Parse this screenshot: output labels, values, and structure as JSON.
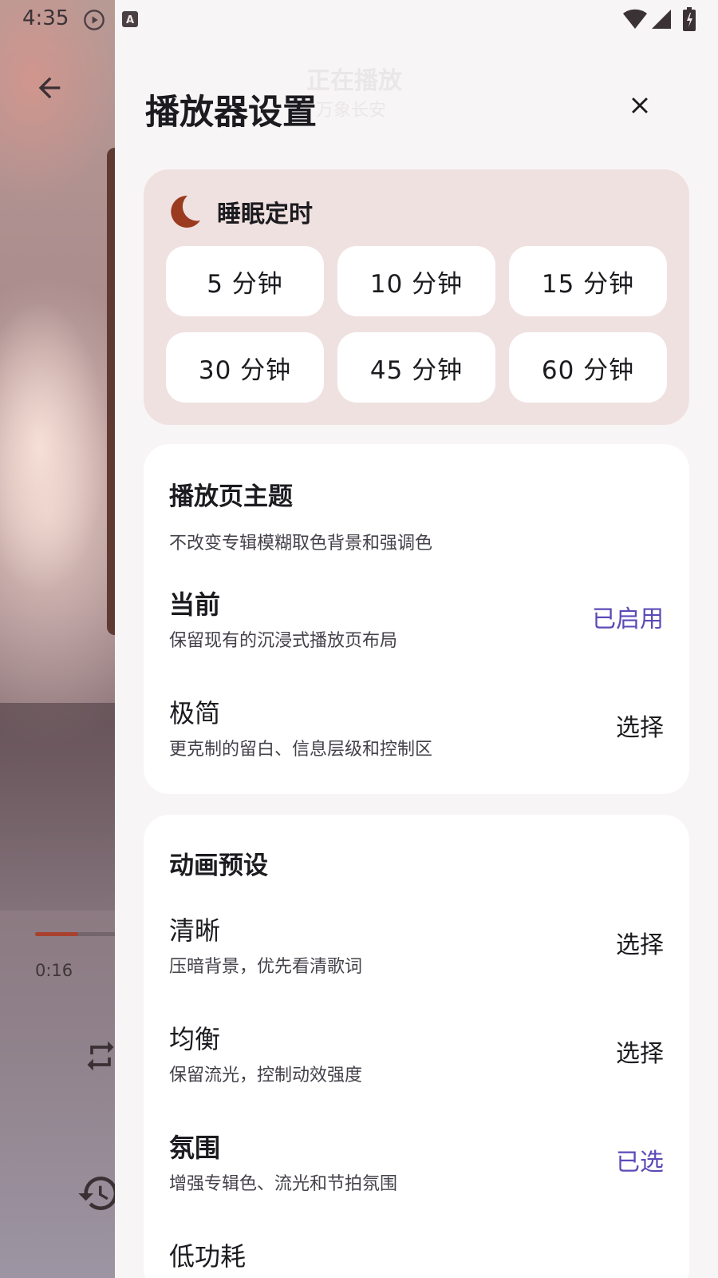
{
  "status_bar": {
    "time": "4:35"
  },
  "background": {
    "elapsed_time": "0:16",
    "progress_fraction": 0.05
  },
  "drawer": {
    "ghost_title": "正在播放",
    "ghost_subtitle": "万象长安",
    "title": "播放器设置",
    "sleep_timer": {
      "title": "睡眠定时",
      "options": [
        "5 分钟",
        "10 分钟",
        "15 分钟",
        "30 分钟",
        "45 分钟",
        "60 分钟"
      ]
    },
    "theme": {
      "title": "播放页主题",
      "description": "不改变专辑模糊取色背景和强调色",
      "options": [
        {
          "name": "当前",
          "subtitle": "保留现有的沉浸式播放页布局",
          "action": "已启用",
          "active": true
        },
        {
          "name": "极简",
          "subtitle": "更克制的留白、信息层级和控制区",
          "action": "选择",
          "active": false
        }
      ]
    },
    "animation": {
      "title": "动画预设",
      "options": [
        {
          "name": "清晰",
          "subtitle": "压暗背景，优先看清歌词",
          "action": "选择",
          "active": false
        },
        {
          "name": "均衡",
          "subtitle": "保留流光，控制动效强度",
          "action": "选择",
          "active": false
        },
        {
          "name": "氛围",
          "subtitle": "增强专辑色、流光和节拍氛围",
          "action": "已选",
          "active": true
        },
        {
          "name": "低功耗"
        }
      ]
    }
  },
  "colors": {
    "accent": "#5b4bb7",
    "progress": "#a8412e",
    "moon": "#9a3a1f",
    "sleep_card": "#f0e1e1"
  }
}
